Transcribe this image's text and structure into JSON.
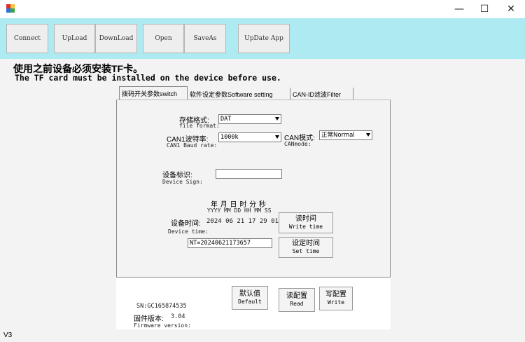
{
  "window": {
    "minimize_glyph": "—",
    "maximize_glyph": "☐",
    "close_glyph": "✕"
  },
  "toolbar": {
    "connect": "Connect",
    "upload": "UpLoad",
    "download": "DownLoad",
    "open": "Open",
    "saveas": "SaveAs",
    "update_app": "UpDate App"
  },
  "notice": {
    "cn": "使用之前设备必须安装TF卡。",
    "en": "The TF card must be installed on the device before use."
  },
  "tabs": [
    {
      "label": "拨码开关参数switch",
      "selected": true
    },
    {
      "label": "软件设定参数Software setting",
      "selected": false
    },
    {
      "label": "CAN-ID滤波Filter",
      "selected": false
    }
  ],
  "form": {
    "storage_format": {
      "label_cn": "存储格式:",
      "label_en": "file format:",
      "value": "DAT"
    },
    "can1_baud": {
      "label_cn": "CAN1波特率:",
      "label_en": "CAN1 Baud rate:",
      "value": "1000k"
    },
    "can_mode": {
      "label_cn": "CAN模式:",
      "label_en": "CANmode:",
      "value": "正常Normal"
    },
    "device_sign": {
      "label_cn": "设备标识:",
      "label_en": "Device Sign:",
      "value": ""
    },
    "time_header_cn": "年 月 日 时 分 秒",
    "time_header_en": "YYYY MM DD HH MM SS",
    "device_time": {
      "label_cn": "设备时间:",
      "label_en": "Device time:",
      "value": "2024 06 21 17 29 01"
    },
    "nt_value": "NT=20240621173657",
    "read_time": {
      "cn": "读时间",
      "en": "Write time"
    },
    "set_time": {
      "cn": "设定时间",
      "en": "Set time"
    }
  },
  "actions": {
    "default": {
      "cn": "默认值",
      "en": "Default"
    },
    "read": {
      "cn": "读配置",
      "en": "Read"
    },
    "write": {
      "cn": "写配置",
      "en": "Write"
    }
  },
  "info": {
    "sn": "SN:GC165874535",
    "firmware_cn": "固件版本:",
    "firmware_value": "3.04",
    "firmware_en": "Firmware version:"
  },
  "status": {
    "version": "V3"
  },
  "colors": {
    "toolbar_bg": "#aeeaf2",
    "window_bg": "#f3f3f3"
  }
}
